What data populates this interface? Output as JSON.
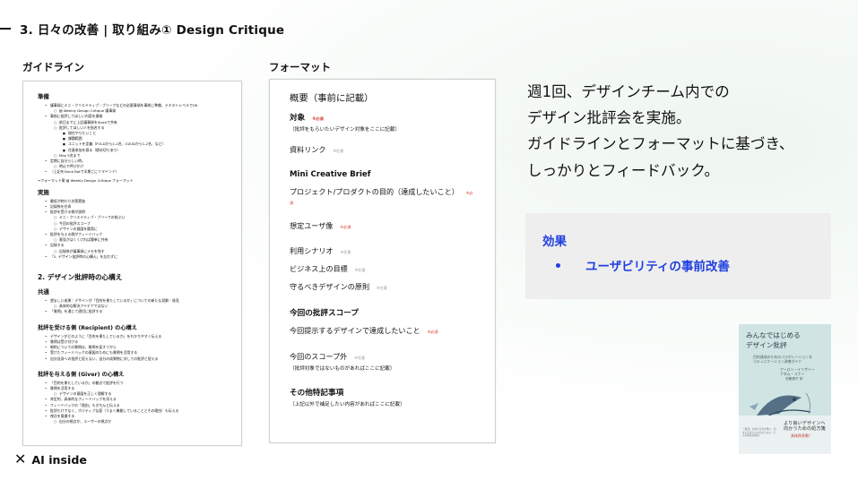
{
  "header": {
    "title": "3. 日々の改善 | 取り組み①  Design Critique"
  },
  "labels": {
    "guideline": "ガイドライン",
    "format": "フォーマット"
  },
  "guideline": {
    "prep_title": "準備",
    "prep": [
      {
        "lvl": 1,
        "text": "議事録にミニ・クリエイティブ・ブリーフなどの必要事項を事前に準備、テキストレベルでOK"
      },
      {
        "lvl": 2,
        "text": "▤ Weekly Design Critique 議事録"
      },
      {
        "lvl": 1,
        "text": "事前に批評してほしい内容を連絡"
      },
      {
        "lvl": 2,
        "text": "前日までに上記議事録をSlackで共有"
      },
      {
        "lvl": 2,
        "text": "批評してほしい人を指名する"
      },
      {
        "lvl": 3,
        "text": "現在やりたいこと"
      },
      {
        "lvl": 3,
        "text": "課題範囲"
      },
      {
        "lvl": 3,
        "text": "ユニットを定義（FOLDから1-2名、O2UDから1-2名、など）"
      },
      {
        "lvl": 3,
        "text": "任意参加を募る（締め切りあり）"
      },
      {
        "lvl": 2,
        "text": "Max 5名まで"
      },
      {
        "lvl": 1,
        "text": "定期に自分らしい時。"
      },
      {
        "lvl": 2,
        "text": "時込で呼びかけ"
      },
      {
        "lvl": 1,
        "text": "（上記をSlack Botで半期ごにリマインド）"
      }
    ],
    "format_link": "→フォーマット案 ▤ Weekly Design Critique フォーマット",
    "exec_title": "実施",
    "exec": [
      {
        "lvl": 1,
        "text": "最低が終わり次第実施"
      },
      {
        "lvl": 1,
        "text": "記録係を任命"
      },
      {
        "lvl": 1,
        "text": "批評を受ける側が説明"
      },
      {
        "lvl": 2,
        "text": "ミニ・クリエイティブ・ブリーフの結ぶい"
      },
      {
        "lvl": 2,
        "text": "今回の批評スコープ"
      },
      {
        "lvl": 2,
        "text": "デザインの意図を簡潔に"
      },
      {
        "lvl": 1,
        "text": "批評を与える側がフィードバック"
      },
      {
        "lvl": 2,
        "text": "意見がはくくければ簡単に共有"
      },
      {
        "lvl": 1,
        "text": "記録する"
      },
      {
        "lvl": 2,
        "text": "記録係が議事録にメモを残す"
      },
      {
        "lvl": 1,
        "text": "「2. デザイン批評時の心構え」を忘れずに"
      }
    ],
    "mind_title": "2. デザイン批評時の心構え",
    "common_title": "共通",
    "common": [
      {
        "lvl": 1,
        "text": "望ましい成果：デザインが「目的を果たしているか」についての新たな見解・発見"
      },
      {
        "lvl": 2,
        "text": "具体的な解決アイデアではない"
      },
      {
        "lvl": 1,
        "text": "「質問」を通じて適切に批評する"
      }
    ],
    "recv_title": "批評を受ける側 (Recipient) の心構え",
    "recv": [
      {
        "lvl": 1,
        "text": "デザインがどのように「目的を果たしているか」をわかりやすく伝える"
      },
      {
        "lvl": 1,
        "text": "質問は受け付ける"
      },
      {
        "lvl": 1,
        "text": "制約についての質問は、質問を促すうから"
      },
      {
        "lvl": 1,
        "text": "受けたフィードバックの意図のためにも質問を活用する"
      },
      {
        "lvl": 1,
        "text": "自分自身への批評と捉えない、自分の成果物に対しての批評と捉える"
      }
    ],
    "giver_title": "批評を与える側 (Giver) の心構え",
    "giver": [
      {
        "lvl": 1,
        "text": "「目的を果たしているか」の観点で批評を行う"
      },
      {
        "lvl": 1,
        "text": "質問を活用する"
      },
      {
        "lvl": 2,
        "text": "デザインの意図を正しく理解する"
      },
      {
        "lvl": 1,
        "text": "肯定的、具体的なフィードバックを添える"
      },
      {
        "lvl": 1,
        "text": "フィードバックの「理由」もきちんと伝える"
      },
      {
        "lvl": 1,
        "text": "批評だけでなく、ポジティブな面（うまく機能していることとその理由）も伝える"
      },
      {
        "lvl": 1,
        "text": "視点を意識する"
      },
      {
        "lvl": 2,
        "text": "自分の視点か、ユーザーの視点か"
      }
    ]
  },
  "format": {
    "title": "概要（事前に記載）",
    "required": "※必須",
    "optional": "※任意",
    "target_label": "対象",
    "target_hint": "（批評をもらいたいデザイン対象をここに記載）",
    "material_label": "資料リンク",
    "brief_title": "Mini Creative Brief",
    "purpose_label": "プロジェクト/プロダクトの目的（達成したいこと）",
    "user_label": "想定ユーザ像",
    "scenario_label": "利用シナリオ",
    "business_label": "ビジネス上の目標",
    "principle_label": "守るべきデザインの原則",
    "scope_title": "今回の批評スコープ",
    "scope_label": "今回提示するデザインで達成したいこと",
    "outscope_label": "今回のスコープ外",
    "outscope_hint": "（批評対象ではないものがあればここに記載）",
    "other_title": "その他特記事項",
    "other_hint": "（上記以外で補足したい内容があればここに記載）"
  },
  "summary": {
    "line1": "週1回、デザインチーム内での",
    "line2": "デザイン批評会を実施。",
    "line3": "ガイドラインとフォーマットに基づき、",
    "line4": "しっかりとフィードバック。"
  },
  "effect": {
    "title": "効果",
    "item": "ユーザビリティの事前改善"
  },
  "book": {
    "title_line1": "みんなではじめる",
    "title_line2": "デザイン批評",
    "subtitle1": "目的達成のためのコラボレーション＆",
    "subtitle2": "コミュニケーション改善ガイド",
    "authors1": "アーロン・イリザリー",
    "authors2": "アダム・コナー",
    "translator": "安藤貴子 訳",
    "band1": "より良いデザインへ",
    "band2": "向かうための処方箋",
    "band_red": "具体例多数！",
    "band_left": "「批評」を受けるのが怖い、何を言えばいいかわからない…そんな悩みを解決"
  },
  "logo": {
    "text": "AI inside"
  }
}
